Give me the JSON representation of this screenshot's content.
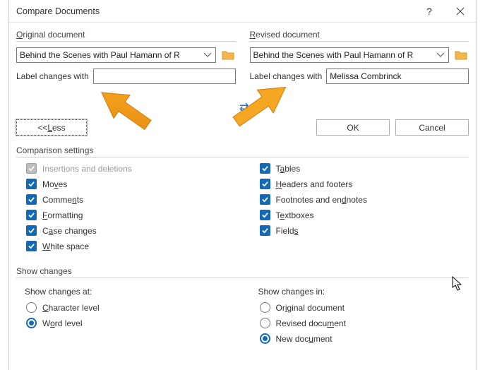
{
  "dialog": {
    "title": "Compare Documents"
  },
  "original": {
    "group": "Original document",
    "selected": "Behind the Scenes with Paul Hamann of R",
    "label_changes": "Label changes with",
    "author": ""
  },
  "revised": {
    "group": "Revised document",
    "selected": "Behind the Scenes with Paul Hamann of R",
    "label_changes": "Label changes with",
    "author": "Melissa Combrinck"
  },
  "buttons": {
    "less": "<< Less",
    "ok": "OK",
    "cancel": "Cancel"
  },
  "sections": {
    "comparison": "Comparison settings",
    "show": "Show changes"
  },
  "comparison": {
    "leftcol": {
      "insdel": "Insertions and deletions",
      "moves": "Moves",
      "comments": "Comments",
      "formatting": "Formatting",
      "case": "Case changes",
      "white": "White space"
    },
    "rightcol": {
      "tables": "Tables",
      "headers": "Headers and footers",
      "footnotes": "Footnotes and endnotes",
      "textboxes": "Textboxes",
      "fields": "Fields"
    }
  },
  "show_at": {
    "head": "Show changes at:",
    "char": "Character level",
    "word": "Word level"
  },
  "show_in": {
    "head": "Show changes in:",
    "orig": "Original document",
    "rev": "Revised document",
    "newd": "New document"
  }
}
